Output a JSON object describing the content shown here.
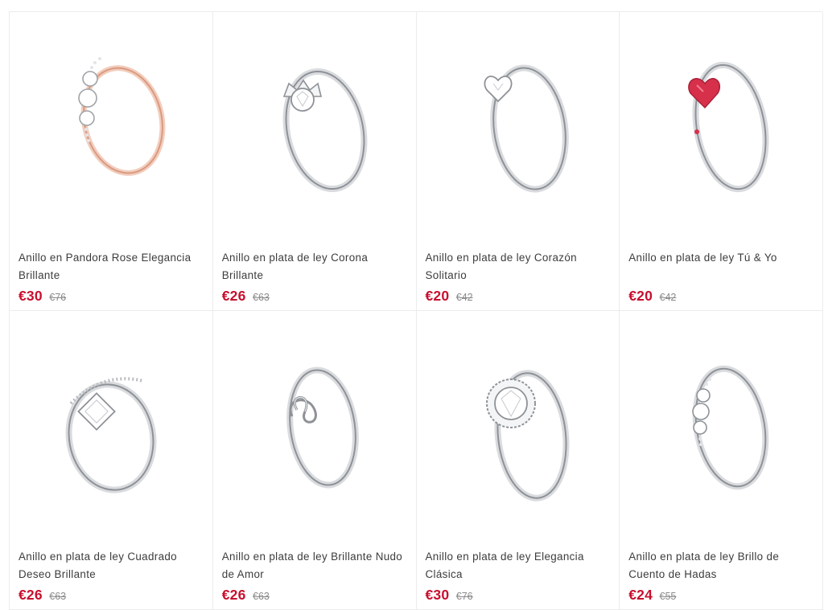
{
  "products": [
    {
      "title": "Anillo en Pandora Rose Elegancia Brillante",
      "price": "€30",
      "old_price": "€76",
      "image_icon": "rose-gold-ring-icon"
    },
    {
      "title": "Anillo en plata de ley Corona Brillante",
      "price": "€26",
      "old_price": "€63",
      "image_icon": "silver-crown-ring-icon"
    },
    {
      "title": "Anillo en plata de ley Corazón Solitario",
      "price": "€20",
      "old_price": "€42",
      "image_icon": "silver-solitaire-heart-ring-icon"
    },
    {
      "title": "Anillo en plata de ley Tú & Yo",
      "price": "€20",
      "old_price": "€42",
      "image_icon": "red-heart-ring-icon"
    },
    {
      "title": "Anillo en plata de ley Cuadrado Deseo Brillante",
      "price": "€26",
      "old_price": "€63",
      "image_icon": "wishbone-square-ring-icon"
    },
    {
      "title": "Anillo en plata de ley Brillante Nudo de Amor",
      "price": "€26",
      "old_price": "€63",
      "image_icon": "love-knot-ring-icon"
    },
    {
      "title": "Anillo en plata de ley Elegancia Clásica",
      "price": "€30",
      "old_price": "€76",
      "image_icon": "halo-ring-icon"
    },
    {
      "title": "Anillo en plata de ley Brillo de Cuento de Hadas",
      "price": "€24",
      "old_price": "€55",
      "image_icon": "three-stone-ring-icon"
    }
  ],
  "colors": {
    "price": "#c8102e",
    "old_price": "#8a8a8a",
    "title": "#3c3c3c",
    "border": "#ececec",
    "silver": "#b9bcc0",
    "rose_gold": "#e3a98e",
    "heart_red": "#d6304a"
  }
}
